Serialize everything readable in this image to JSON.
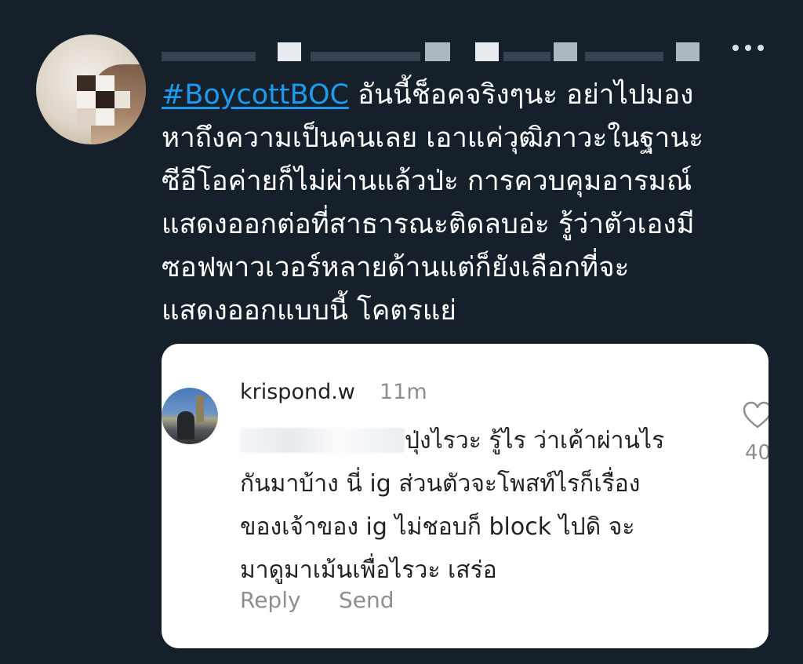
{
  "tweet": {
    "avatar_icon": "avatar-pixelated",
    "more_icon": "more-horizontal-icon",
    "hashtag": "#BoycottBOC",
    "text_lines": [
      " อันนี้ช็อคจริงๆนะ อย่าไปมอง",
      "หาถึงความเป็นคนเลย เอาแค่วุฒิภาวะในฐานะ",
      "ซีอีโอค่ายก็ไม่ผ่านแล้วป่ะ การควบคุมอารมณ์",
      "แสดงออกต่อที่สาธารณะติดลบอ่ะ รู้ว่าตัวเองมี",
      "ซอฟพาวเวอร์หลายด้านแต่ก็ยังเลือกที่จะ",
      "แสดงออกแบบนี้ โคตรแย่"
    ],
    "accent_color": "#1d9bf0",
    "background_color": "#15202b"
  },
  "card": {
    "username": "krispond.w",
    "time": "11m",
    "comment_lines": [
      "ปุ่งไรวะ รู้ไร ว่าเค้าผ่านไร",
      "กันมาบ้าง นี่ ig ส่วนตัวจะโพสท์ไรก็เรื่อง",
      "ของเจ้าของ ig ไม่ชอบก็ block ไปดิ จะ",
      "มาดูมาเม้นเพื่อไรวะ เสร่อ"
    ],
    "reply_label": "Reply",
    "send_label": "Send",
    "likes": "40",
    "heart_icon": "heart-outline-icon"
  }
}
